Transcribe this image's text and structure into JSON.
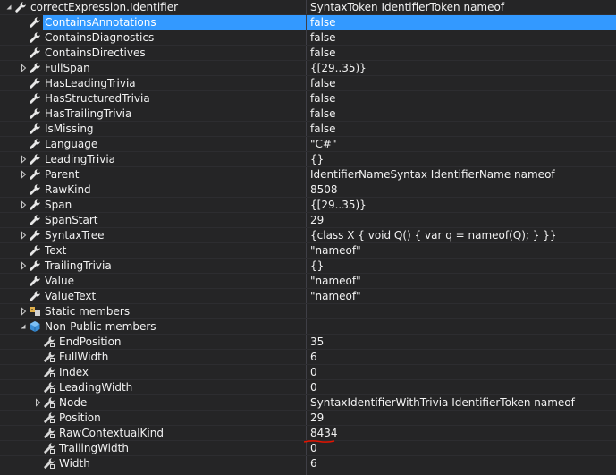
{
  "window": {
    "width": 689,
    "height": 531
  },
  "colors": {
    "background": "#252526",
    "selection": "#3399ff",
    "text": "#f1f1f1",
    "underline": "#e51400"
  },
  "rows": [
    {
      "name": "correctExpression.Identifier",
      "value": "SyntaxToken IdentifierToken nameof",
      "expander": "expanded",
      "indent": 0,
      "icon": "wrench-icon",
      "selected": false
    },
    {
      "name": "ContainsAnnotations",
      "value": "false",
      "expander": "none",
      "indent": 1,
      "icon": "wrench-icon",
      "selected": true
    },
    {
      "name": "ContainsDiagnostics",
      "value": "false",
      "expander": "none",
      "indent": 1,
      "icon": "wrench-icon",
      "selected": false
    },
    {
      "name": "ContainsDirectives",
      "value": "false",
      "expander": "none",
      "indent": 1,
      "icon": "wrench-icon",
      "selected": false
    },
    {
      "name": "FullSpan",
      "value": "{[29..35)}",
      "expander": "collapsed",
      "indent": 1,
      "icon": "wrench-icon",
      "selected": false
    },
    {
      "name": "HasLeadingTrivia",
      "value": "false",
      "expander": "none",
      "indent": 1,
      "icon": "wrench-icon",
      "selected": false
    },
    {
      "name": "HasStructuredTrivia",
      "value": "false",
      "expander": "none",
      "indent": 1,
      "icon": "wrench-icon",
      "selected": false
    },
    {
      "name": "HasTrailingTrivia",
      "value": "false",
      "expander": "none",
      "indent": 1,
      "icon": "wrench-icon",
      "selected": false
    },
    {
      "name": "IsMissing",
      "value": "false",
      "expander": "none",
      "indent": 1,
      "icon": "wrench-icon",
      "selected": false
    },
    {
      "name": "Language",
      "value": "\"C#\"",
      "expander": "none",
      "indent": 1,
      "icon": "wrench-icon",
      "selected": false
    },
    {
      "name": "LeadingTrivia",
      "value": "{}",
      "expander": "collapsed",
      "indent": 1,
      "icon": "wrench-icon",
      "selected": false
    },
    {
      "name": "Parent",
      "value": "IdentifierNameSyntax IdentifierName nameof",
      "expander": "collapsed",
      "indent": 1,
      "icon": "wrench-icon",
      "selected": false
    },
    {
      "name": "RawKind",
      "value": "8508",
      "expander": "none",
      "indent": 1,
      "icon": "wrench-icon",
      "selected": false
    },
    {
      "name": "Span",
      "value": "{[29..35)}",
      "expander": "collapsed",
      "indent": 1,
      "icon": "wrench-icon",
      "selected": false
    },
    {
      "name": "SpanStart",
      "value": "29",
      "expander": "none",
      "indent": 1,
      "icon": "wrench-icon",
      "selected": false
    },
    {
      "name": "SyntaxTree",
      "value": "{class X { void Q() { var q = nameof(Q); } }}",
      "expander": "collapsed",
      "indent": 1,
      "icon": "wrench-icon",
      "selected": false
    },
    {
      "name": "Text",
      "value": "\"nameof\"",
      "expander": "none",
      "indent": 1,
      "icon": "wrench-icon",
      "selected": false
    },
    {
      "name": "TrailingTrivia",
      "value": "{}",
      "expander": "collapsed",
      "indent": 1,
      "icon": "wrench-icon",
      "selected": false
    },
    {
      "name": "Value",
      "value": "\"nameof\"",
      "expander": "none",
      "indent": 1,
      "icon": "wrench-icon",
      "selected": false
    },
    {
      "name": "ValueText",
      "value": "\"nameof\"",
      "expander": "none",
      "indent": 1,
      "icon": "wrench-icon",
      "selected": false
    },
    {
      "name": "Static members",
      "value": "",
      "expander": "collapsed",
      "indent": 1,
      "icon": "static-members-icon",
      "selected": false
    },
    {
      "name": "Non-Public members",
      "value": "",
      "expander": "expanded",
      "indent": 1,
      "icon": "non-public-members-icon",
      "selected": false
    },
    {
      "name": "EndPosition",
      "value": "35",
      "expander": "none",
      "indent": 2,
      "icon": "private-wrench-icon",
      "selected": false
    },
    {
      "name": "FullWidth",
      "value": "6",
      "expander": "none",
      "indent": 2,
      "icon": "private-wrench-icon",
      "selected": false
    },
    {
      "name": "Index",
      "value": "0",
      "expander": "none",
      "indent": 2,
      "icon": "private-wrench-icon",
      "selected": false
    },
    {
      "name": "LeadingWidth",
      "value": "0",
      "expander": "none",
      "indent": 2,
      "icon": "private-wrench-icon",
      "selected": false
    },
    {
      "name": "Node",
      "value": "SyntaxIdentifierWithTrivia IdentifierToken nameof",
      "expander": "collapsed",
      "indent": 2,
      "icon": "private-wrench-icon",
      "selected": false
    },
    {
      "name": "Position",
      "value": "29",
      "expander": "none",
      "indent": 2,
      "icon": "private-wrench-icon",
      "selected": false
    },
    {
      "name": "RawContextualKind",
      "value": "8434",
      "expander": "none",
      "indent": 2,
      "icon": "private-wrench-icon",
      "selected": false,
      "underlined": true
    },
    {
      "name": "TrailingWidth",
      "value": "0",
      "expander": "none",
      "indent": 2,
      "icon": "private-wrench-icon",
      "selected": false
    },
    {
      "name": "Width",
      "value": "6",
      "expander": "none",
      "indent": 2,
      "icon": "private-wrench-icon",
      "selected": false
    }
  ]
}
